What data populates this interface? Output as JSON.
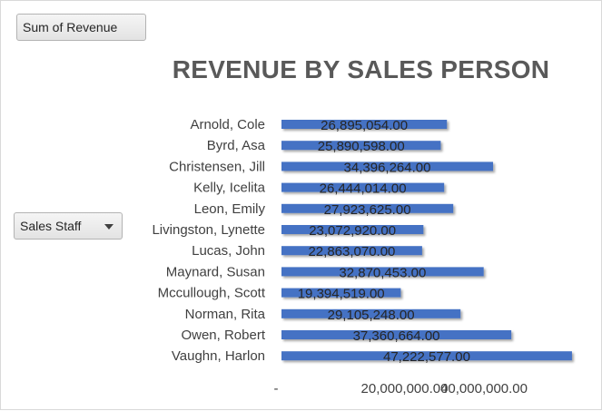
{
  "controls": {
    "value_field": "Sum of Revenue",
    "row_field": "Sales Staff"
  },
  "chart_data": {
    "type": "bar",
    "orientation": "horizontal",
    "title": "REVENUE BY SALES PERSON",
    "categories": [
      "Arnold, Cole",
      "Byrd, Asa",
      "Christensen, Jill",
      "Kelly, Icelita",
      "Leon, Emily",
      "Livingston, Lynette",
      "Lucas, John",
      "Maynard, Susan",
      "Mccullough, Scott",
      "Norman, Rita",
      "Owen, Robert",
      "Vaughn, Harlon"
    ],
    "values": [
      26895054,
      25890598,
      34396264,
      26444014,
      27923625,
      23072920,
      22863070,
      32870453,
      19394519,
      29105248,
      37360664,
      47222577
    ],
    "value_labels": [
      "26,895,054.00",
      "25,890,598.00",
      "34,396,264.00",
      "26,444,014.00",
      "27,923,625.00",
      "23,072,920.00",
      "22,863,070.00",
      "32,870,453.00",
      "19,394,519.00",
      "29,105,248.00",
      "37,360,664.00",
      "47,222,577.00"
    ],
    "xlim": [
      0,
      40000000
    ],
    "x_ticks": [
      {
        "value": 0,
        "label": "-"
      },
      {
        "value": 20000000,
        "label": "20,000,000.00"
      },
      {
        "value": 40000000,
        "label": "40,000,000.00"
      }
    ],
    "bar_color": "#4472c4",
    "grid": false,
    "legend": "none"
  }
}
